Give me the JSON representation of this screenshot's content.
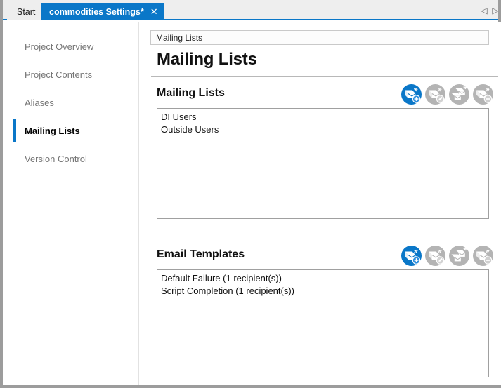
{
  "window": {
    "tabs": [
      {
        "label": "Start",
        "active": false,
        "closable": false
      },
      {
        "label": "commodities Settings*",
        "active": true,
        "closable": true
      }
    ],
    "tab_close_glyph": "✕",
    "nav_prev_glyph": "◁",
    "nav_next_glyph": "▷",
    "accent_color": "#0a77c8"
  },
  "sidebar": {
    "items": [
      {
        "label": "Project Overview",
        "selected": false
      },
      {
        "label": "Project Contents",
        "selected": false
      },
      {
        "label": "Aliases",
        "selected": false
      },
      {
        "label": "Mailing Lists",
        "selected": true
      },
      {
        "label": "Version Control",
        "selected": false
      }
    ]
  },
  "content": {
    "breadcrumb": "Mailing Lists",
    "page_title": "Mailing Lists",
    "sections": [
      {
        "title": "Mailing Lists",
        "toolbar": [
          {
            "name": "add-mailing-list-button",
            "icon": "mail-add-icon",
            "enabled": true
          },
          {
            "name": "edit-mailing-list-button",
            "icon": "mail-edit-icon",
            "enabled": false
          },
          {
            "name": "copy-mailing-list-button",
            "icon": "mail-copy-icon",
            "enabled": false
          },
          {
            "name": "remove-mailing-list-button",
            "icon": "mail-remove-icon",
            "enabled": false
          }
        ],
        "items": [
          "DI Users",
          "Outside Users"
        ]
      },
      {
        "title": "Email Templates",
        "toolbar": [
          {
            "name": "add-email-template-button",
            "icon": "mail-add-icon",
            "enabled": true
          },
          {
            "name": "edit-email-template-button",
            "icon": "mail-edit-icon",
            "enabled": false
          },
          {
            "name": "copy-email-template-button",
            "icon": "mail-copy-icon",
            "enabled": false
          },
          {
            "name": "remove-email-template-button",
            "icon": "mail-remove-icon",
            "enabled": false
          }
        ],
        "items": [
          "Default Failure (1 recipient(s))",
          "Script Completion (1 recipient(s))"
        ]
      }
    ]
  }
}
